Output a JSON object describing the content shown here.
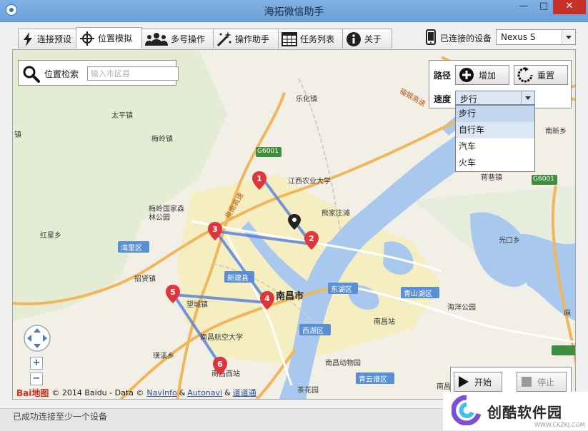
{
  "window": {
    "title": "海拓微信助手"
  },
  "tabs": [
    {
      "label": "连接预设",
      "icon": "lightning-icon"
    },
    {
      "label": "位置模拟",
      "icon": "crosshair-icon"
    },
    {
      "label": "多号操作",
      "icon": "users-icon"
    },
    {
      "label": "操作助手",
      "icon": "magic-wand-icon"
    },
    {
      "label": "任务列表",
      "icon": "table-icon"
    },
    {
      "label": "关于",
      "icon": "info-icon"
    }
  ],
  "active_tab": "位置模拟",
  "device": {
    "label": "已连接的设备",
    "selected": "Nexus S"
  },
  "search": {
    "label": "位置检索",
    "placeholder": "输入市区县"
  },
  "route_panel": {
    "route_label": "路径",
    "add_label": "增加",
    "reset_label": "重置",
    "speed_label": "速度",
    "speed_selected": "步行",
    "speed_options": [
      "步行",
      "自行车",
      "汽车",
      "火车"
    ]
  },
  "controls": {
    "start_label": "开始",
    "stop_label": "停止"
  },
  "map": {
    "labels": {
      "lehua": "乐化镇",
      "taiping": "太平镇",
      "meiling": "梅岭镇",
      "zhen_left": "镇",
      "jiangxi_agri": "江西农业大学",
      "xiongjiazhuang": "熊家庄滩",
      "meiling_park": "梅岭国家森林公园",
      "honglian": "红星乡",
      "wanli": "湾里区",
      "xinjian": "新建县",
      "zhaoxian": "招贤镇",
      "nanchang": "南昌市",
      "donghu": "东湖区",
      "qingshanhu": "青山湖区",
      "haiyang_park": "海洋公园",
      "nanchang_station": "南昌站",
      "xihu": "西湖区",
      "wangcheng": "望城镇",
      "hangkong": "南昌航空大学",
      "zoo": "南昌动物园",
      "xiqi": "璜溪乡",
      "west_station": "南昌西站",
      "qingyunpu": "青云谱区",
      "chahua": "茶花园",
      "jiangjia": "蒋巷镇",
      "guangkou": "光口乡",
      "nanxin": "南新乡",
      "mayi": "麻",
      "nanchang_edge": "南昌",
      "jianghu": "蒋巷",
      "fuyin": "福银高速",
      "quanshui": "泉南高速",
      "g60": "G6001"
    },
    "route_points": [
      "1",
      "2",
      "3",
      "4",
      "5",
      "6"
    ]
  },
  "attribution": {
    "logo": "Bai地图",
    "prefix": "© 2014 Baidu - Data ©",
    "navinfo": "NavInfo",
    "amp1": "&",
    "autonavi": "Autonavi",
    "amp2": "&",
    "daodao": "道道通"
  },
  "status": {
    "text": "已成功连接至少一个设备"
  },
  "watermark": {
    "text": "创酷软件园",
    "sub": "WWW.CKZKJ.COM"
  },
  "colors": {
    "accent": "#2e76c9",
    "route": "#5b84d8",
    "marker": "#e0353b",
    "close": "#c7312a"
  }
}
